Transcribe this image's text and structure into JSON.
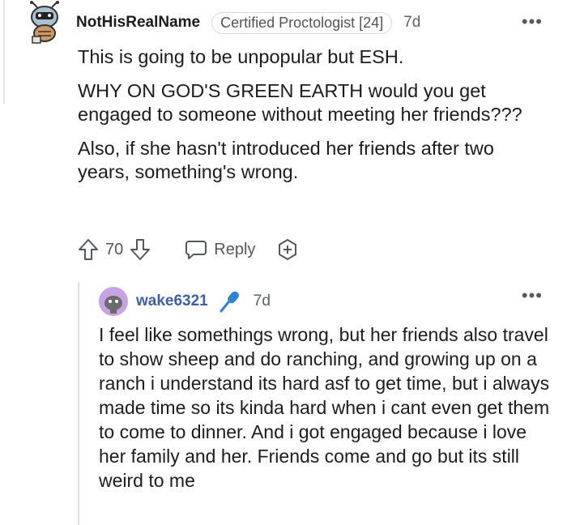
{
  "comment": {
    "username": "NotHisRealName",
    "flair": "Certified Proctologist [24]",
    "age": "7d",
    "paragraphs": [
      "This is going to be unpopular but ESH.",
      "WHY ON GOD'S GREEN EARTH would you get engaged to someone without meeting her friends???",
      "Also, if she hasn't introduced her friends after two years, something's wrong."
    ],
    "vote_count": "70",
    "reply_label": "Reply",
    "avatar_icon": "snoo-avatar-icon"
  },
  "reply": {
    "username": "wake6321",
    "badge_icon": "microphone-icon",
    "age": "7d",
    "text": "I feel like somethings wrong, but her friends also travel to show sheep and do ranching, and growing up on a ranch i understand its hard asf to get time, but i always made time so its kinda hard when i cant even get them to come to dinner. And i got engaged because i love her family and her. Friends come and go but its still weird to me",
    "avatar_icon": "snoo-avatar-icon"
  },
  "colors": {
    "username_reply": "#3f5fa9",
    "accent_blue": "#2f82cf",
    "avatar_purple": "#c7a3e6"
  }
}
